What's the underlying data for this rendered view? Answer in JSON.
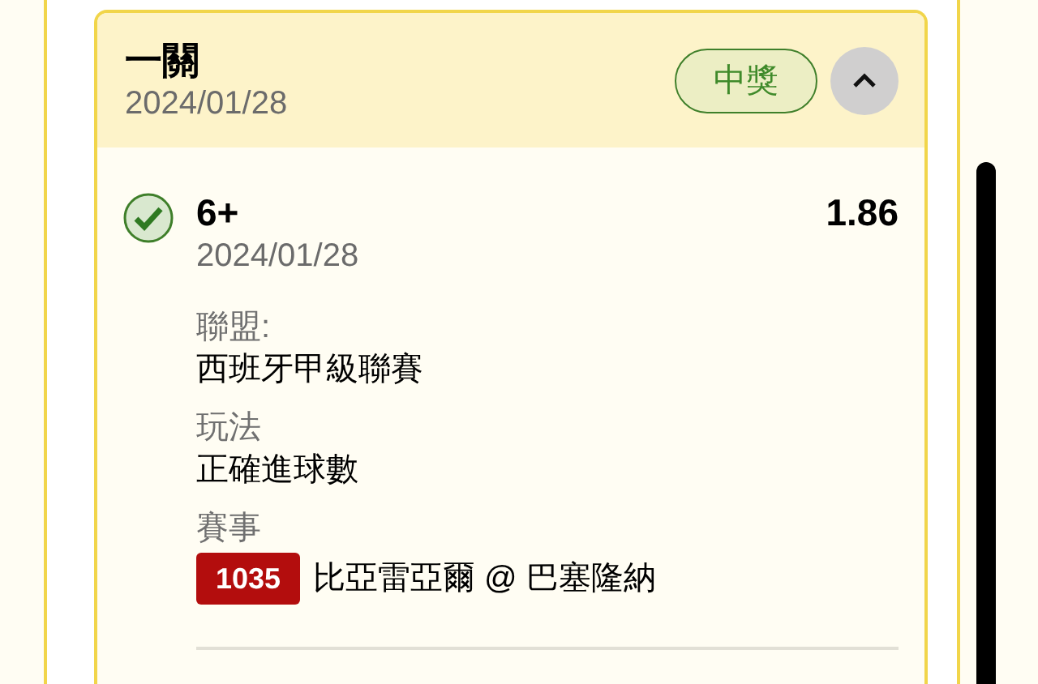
{
  "bet": {
    "title": "一關",
    "date": "2024/01/28",
    "status": "中獎",
    "expanded": true,
    "selections": [
      {
        "pick": "6+",
        "date": "2024/01/28",
        "odds": "1.86",
        "won": true,
        "fields": [
          {
            "label": "聯盟:",
            "value": "西班牙甲級聯賽"
          },
          {
            "label": "玩法",
            "value": "正確進球數"
          }
        ],
        "event_label": "賽事",
        "match_number": "1035",
        "match": "比亞雷亞爾 @ 巴塞隆納"
      }
    ]
  }
}
